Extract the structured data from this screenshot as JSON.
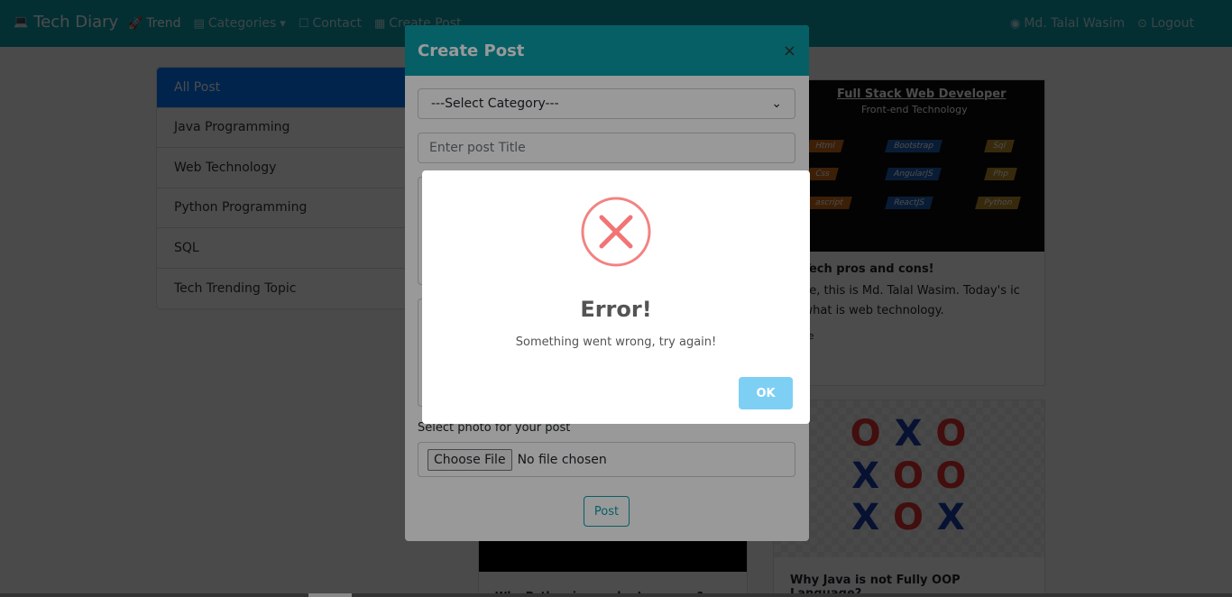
{
  "navbar": {
    "brand": "Tech Diary",
    "items": [
      {
        "label": "Trend",
        "icon": "rocket-icon"
      },
      {
        "label": "Categories",
        "icon": "book-icon"
      },
      {
        "label": "Contact",
        "icon": "contact-icon"
      },
      {
        "label": "Create Post",
        "icon": "post-icon"
      }
    ],
    "user": "Md. Talal Wasim",
    "logout": "Logout"
  },
  "sidebar": {
    "items": [
      {
        "label": "All Post"
      },
      {
        "label": "Java Programming"
      },
      {
        "label": "Web Technology"
      },
      {
        "label": "Python Programming"
      },
      {
        "label": "SQL"
      },
      {
        "label": "Tech Trending Topic"
      }
    ]
  },
  "cards": {
    "web": {
      "banner_title": "Full Stack Web Developer",
      "banner_subtitle": "Front-end Technology",
      "tags": [
        "Html",
        "Css",
        "ascript",
        "Bootstrap",
        "AngularJS",
        "ReactJS",
        "Sql",
        "Php",
        "Python"
      ],
      "title": "b Tech pros and cons!",
      "text": "here, this is Md. Talal Wasim. Today's ic is what is web technology.",
      "code": "code"
    },
    "java": {
      "title": "Why Java is not Fully OOP Language?"
    },
    "python": {
      "title": "Why Python is popular Language?"
    }
  },
  "modal": {
    "title": "Create Post",
    "close": "×",
    "category_placeholder": "---Select Category---",
    "title_placeholder": "Enter post Title",
    "photo_label": "Select photo for your post",
    "file_button": "Choose File",
    "file_status": "No file chosen",
    "post_button": "Post"
  },
  "dialog": {
    "title": "Error!",
    "message": "Something went wrong, try again!",
    "ok": "OK",
    "icon_color": "#f27474",
    "ok_color": "#7ecff4"
  },
  "colors": {
    "navbar": "#0d9eaa",
    "active": "#007bff"
  }
}
